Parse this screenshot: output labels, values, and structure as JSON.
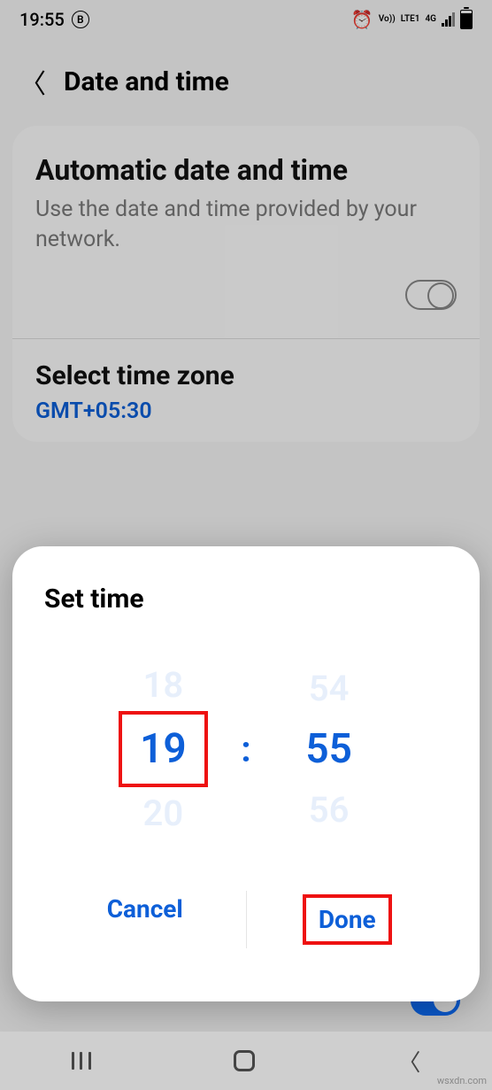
{
  "status_bar": {
    "time": "19:55",
    "badge": "B",
    "net1": "Vo))",
    "net2": "LTE1",
    "net3": "4G"
  },
  "header": {
    "title": "Date and time"
  },
  "auto": {
    "title": "Automatic date and time",
    "subtitle": "Use the date and time provided by your network."
  },
  "timezone": {
    "title": "Select time zone",
    "value": "GMT+05:30"
  },
  "dialog": {
    "title": "Set time",
    "hour_prev": "18",
    "hour": "19",
    "hour_next": "20",
    "colon": ":",
    "min_prev": "54",
    "min": "55",
    "min_next": "56",
    "cancel": "Cancel",
    "done": "Done"
  },
  "watermark": "wsxdn.com"
}
